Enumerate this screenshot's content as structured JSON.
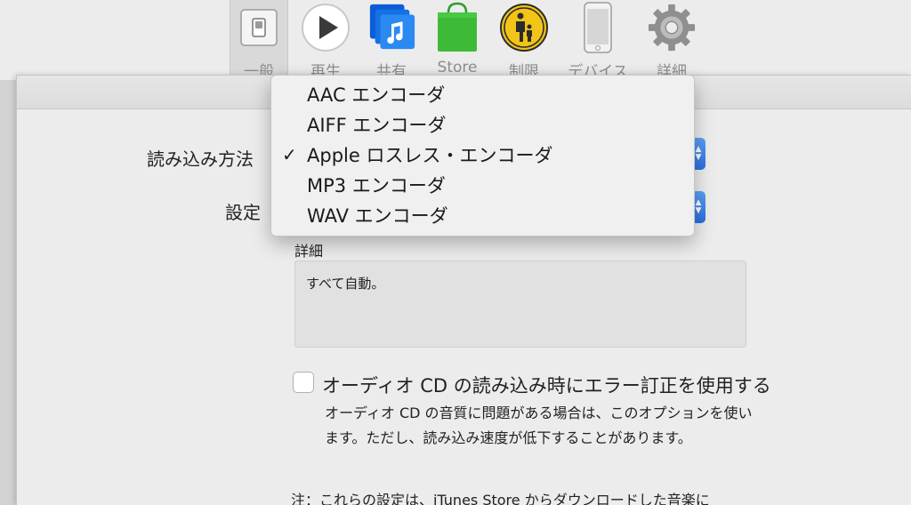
{
  "toolbar": {
    "items": [
      {
        "label": "一般",
        "icon": "general-switch-icon",
        "selected": true
      },
      {
        "label": "再生",
        "icon": "play-icon"
      },
      {
        "label": "共有",
        "icon": "music-sharing-icon"
      },
      {
        "label": "Store",
        "icon": "store-bag-icon"
      },
      {
        "label": "制限",
        "icon": "parental-restrictions-icon"
      },
      {
        "label": "デバイス",
        "icon": "device-phone-icon"
      },
      {
        "label": "詳細",
        "icon": "gear-icon"
      }
    ]
  },
  "form": {
    "import_method_label": "読み込み方法",
    "settings_label": "設定",
    "details_label": "詳細",
    "details_text": "すべて自動。",
    "error_correction_label": "オーディオ CD の読み込み時にエラー訂正を使用する",
    "error_correction_checked": false,
    "help_line1": "オーディオ CD の音質に問題がある場合は、このオプションを使い",
    "help_line2": "ます。ただし、読み込み速度が低下することがあります。",
    "note": "注：これらの設定は、iTunes Store からダウンロードした音楽に"
  },
  "menu": {
    "items": [
      {
        "label": "AAC エンコーダ",
        "checked": false
      },
      {
        "label": "AIFF エンコーダ",
        "checked": false
      },
      {
        "label": "Apple ロスレス・エンコーダ",
        "checked": true
      },
      {
        "label": "MP3 エンコーダ",
        "checked": false
      },
      {
        "label": "WAV エンコーダ",
        "checked": false
      }
    ],
    "check_mark": "✓"
  },
  "colors": {
    "accent_blue": "#2d6fe0",
    "store_green": "#34b233",
    "restrictions_yellow": "#f5c518",
    "music_blue": "#1a73e8"
  }
}
